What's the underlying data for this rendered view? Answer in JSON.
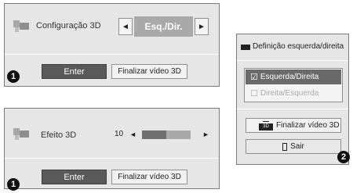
{
  "panel_config": {
    "label": "Configuração 3D",
    "value": "Esq./Dir.",
    "left_arrow": "◄",
    "right_arrow": "►",
    "enter_label": "Enter",
    "finish_label": "Finalizar vídeo 3D",
    "badge": "1"
  },
  "panel_effect": {
    "label": "Efeito 3D",
    "value": "10",
    "left_arrow": "◄",
    "right_arrow": "►",
    "slider_level": 0.5,
    "enter_label": "Enter",
    "finish_label": "Finalizar vídeo 3D",
    "badge": "1"
  },
  "menu": {
    "title": "Definição esquerda/direita",
    "options": [
      {
        "check": "☑",
        "label": "Esquerda/Direita",
        "selected": true
      },
      {
        "check": "☐",
        "label": "Direita/Esquerda",
        "selected": false
      }
    ],
    "finish_label": "Finalizar vídeo 3D",
    "finish_icon": "3D",
    "exit_label": "Sair",
    "badge": "2"
  },
  "colors": {
    "panel_bg": "#e6e6e6",
    "dark_button": "#595959",
    "value_box": "#a9a9a9",
    "selected_option": "#6a6a6a"
  },
  "icons": [
    "3d-glasses-icon",
    "tv-3d-icon",
    "door-exit-icon"
  ]
}
